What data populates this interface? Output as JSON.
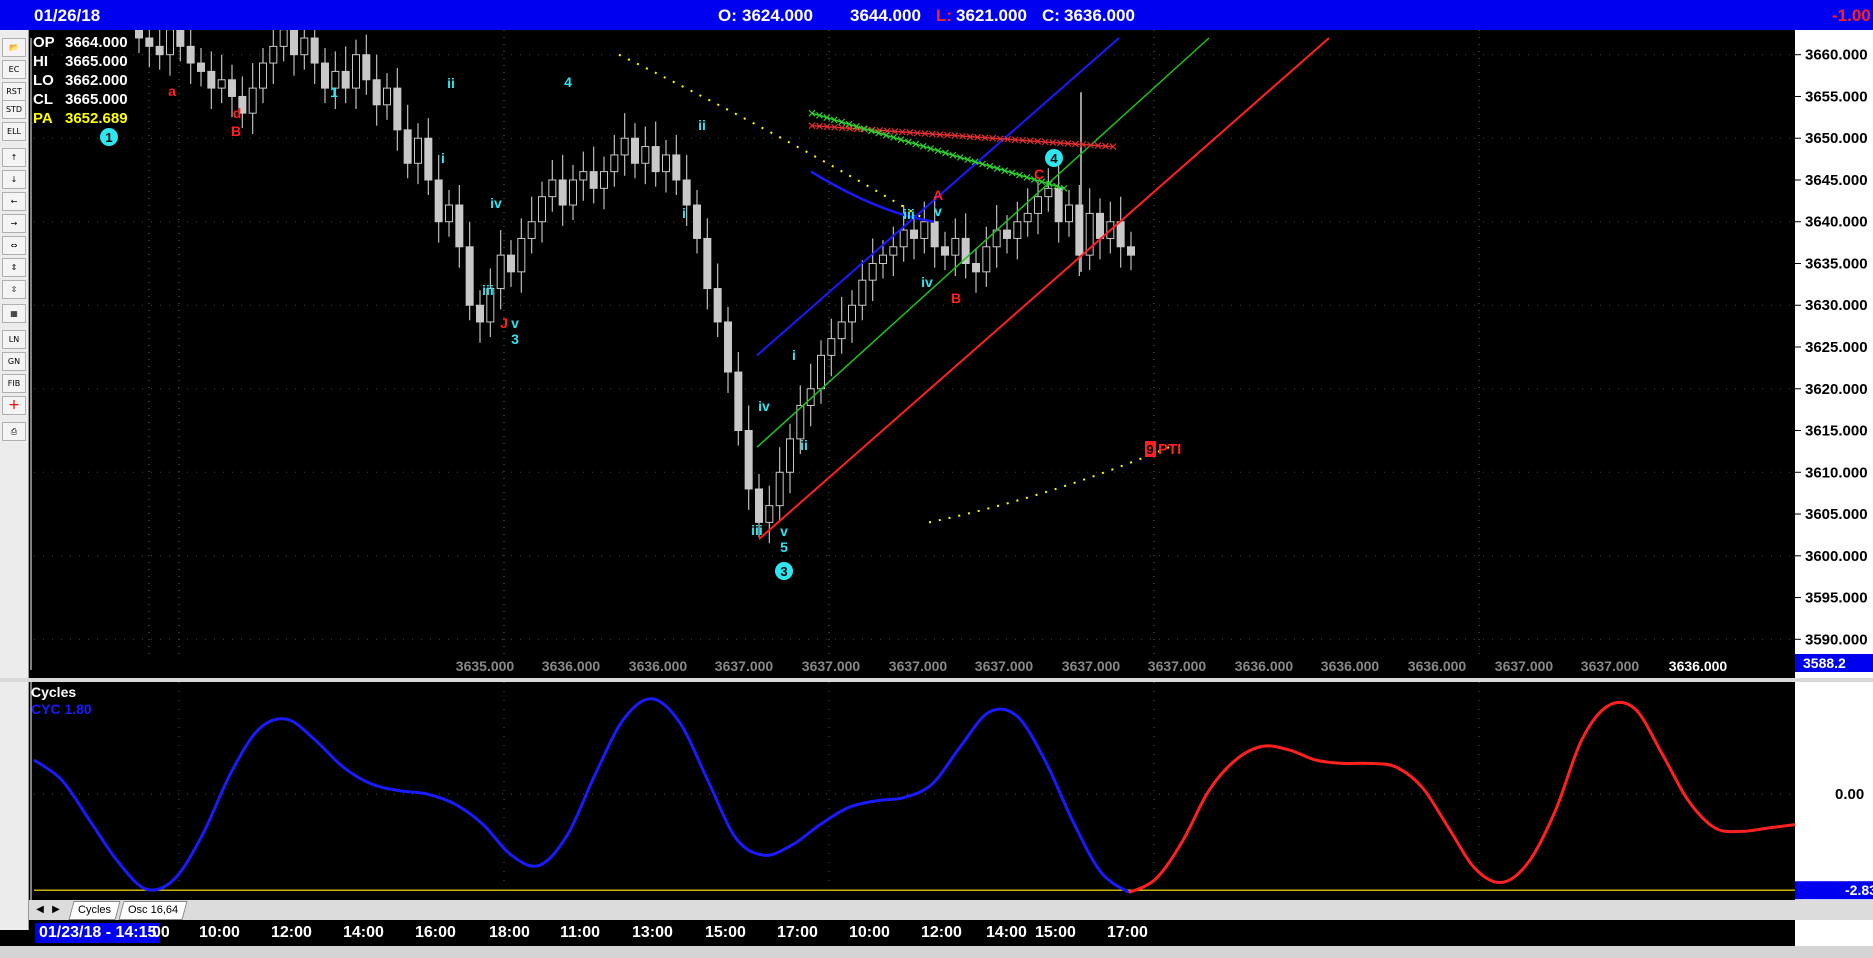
{
  "header": {
    "date": "01/26/18",
    "open_label": "O:",
    "open": "3624.000",
    "high": "3644.000",
    "low_label": "L:",
    "low": "3621.000",
    "close_label": "C:",
    "close": "3636.000",
    "change": "-1.00"
  },
  "toolbar": {
    "tools": [
      "open-folder",
      "elliott-count",
      "reset",
      "study",
      "elliott",
      "up",
      "down",
      "left",
      "right",
      "compress",
      "expand",
      "zoom",
      "grid",
      "lines",
      "gann",
      "fib",
      "crosshair",
      "print"
    ]
  },
  "readout": {
    "op_label": "OP",
    "op": "3664.000",
    "hi_label": "HI",
    "hi": "3665.000",
    "lo_label": "LO",
    "lo": "3662.000",
    "cl_label": "CL",
    "cl": "3665.000",
    "pa_label": "PA",
    "pa": "3652.689"
  },
  "price_axis": {
    "ticks": [
      "3660.000",
      "3655.000",
      "3650.000",
      "3645.000",
      "3640.000",
      "3635.000",
      "3630.000",
      "3625.000",
      "3620.000",
      "3615.000",
      "3610.000",
      "3605.000",
      "3600.000",
      "3595.000",
      "3590.000"
    ],
    "current_box": "3588.2"
  },
  "bottom_row_values": [
    "3635.000",
    "3636.000",
    "3636.000",
    "3637.000",
    "3637.000",
    "3637.000",
    "3637.000",
    "3637.000",
    "3637.000",
    "3636.000",
    "3636.000",
    "3636.000",
    "3637.000",
    "3637.000",
    "3636.000"
  ],
  "wave_labels": [
    {
      "t": "a",
      "c": "red"
    },
    {
      "t": "d",
      "c": "red"
    },
    {
      "t": "B",
      "c": "red"
    },
    {
      "t": "1",
      "c": "cyan"
    },
    {
      "t": "ii",
      "c": "cyan"
    },
    {
      "t": "i",
      "c": "cyan"
    },
    {
      "t": "iv",
      "c": "cyan"
    },
    {
      "t": "iii",
      "c": "cyan"
    },
    {
      "t": "J",
      "c": "red"
    },
    {
      "t": "v",
      "c": "cyan"
    },
    {
      "t": "3",
      "c": "cyan"
    },
    {
      "t": "4",
      "c": "cyan"
    },
    {
      "t": "ii",
      "c": "cyan"
    },
    {
      "t": "i",
      "c": "cyan"
    },
    {
      "t": "iv",
      "c": "cyan"
    },
    {
      "t": "iii",
      "c": "cyan"
    },
    {
      "t": "v",
      "c": "cyan"
    },
    {
      "t": "5",
      "c": "cyan"
    },
    {
      "t": "i",
      "c": "cyan"
    },
    {
      "t": "ii",
      "c": "cyan"
    },
    {
      "t": "iii",
      "c": "cyan"
    },
    {
      "t": "A",
      "c": "red"
    },
    {
      "t": "v",
      "c": "cyan"
    },
    {
      "t": "iv",
      "c": "cyan"
    },
    {
      "t": "B",
      "c": "red"
    },
    {
      "t": "C",
      "c": "red"
    }
  ],
  "circled_labels": [
    "1",
    "3",
    "4"
  ],
  "pti": {
    "score": "9",
    "label": "PTI"
  },
  "oscillator": {
    "title": "Cycles",
    "legend": "CYC 1.80",
    "zero_label": "0.00",
    "min_box": "-2.83"
  },
  "tabs": [
    "Cycles",
    "Osc 16,64"
  ],
  "time_axis": {
    "current_box": "01/23/18 - 14:15",
    "labels": [
      "00",
      "10:00",
      "12:00",
      "14:00",
      "16:00",
      "18:00",
      "11:00",
      "13:00",
      "15:00",
      "17:00",
      "10:00",
      "12:00",
      "14:00",
      "15:00",
      "17:00"
    ]
  },
  "colors": {
    "header_bg": "#0000f0",
    "up_channel": "#ff2020",
    "mid_channel": "#20c020",
    "top_channel": "#1a1aff",
    "osc_history": "#1a1aff",
    "osc_projection": "#ff2020",
    "labels_cyan": "#2ee6f0",
    "labels_red": "#ff2020"
  },
  "chart_data": {
    "type": "candlestick",
    "ylim": [
      3588,
      3662
    ],
    "bars_close": [
      3662,
      3661,
      3660,
      3663,
      3661,
      3659,
      3658,
      3656,
      3657,
      3655,
      3653,
      3656,
      3659,
      3661,
      3663,
      3660,
      3662,
      3659,
      3656,
      3658,
      3656,
      3660,
      3657,
      3654,
      3656,
      3651,
      3647,
      3650,
      3645,
      3640,
      3642,
      3637,
      3630,
      3628,
      3632,
      3636,
      3634,
      3638,
      3640,
      3643,
      3645,
      3642,
      3645,
      3646,
      3644,
      3646,
      3648,
      3650,
      3647,
      3649,
      3646,
      3648,
      3645,
      3642,
      3638,
      3632,
      3628,
      3622,
      3615,
      3608,
      3604,
      3606,
      3610,
      3614,
      3618,
      3620,
      3624,
      3626,
      3628,
      3630,
      3633,
      3635,
      3636,
      3637,
      3639,
      3638,
      3640,
      3637,
      3636,
      3638,
      3635,
      3634,
      3637,
      3639,
      3638,
      3640,
      3641,
      3643,
      3644,
      3640,
      3642,
      3636,
      3641,
      3638,
      3640,
      3637,
      3636
    ],
    "oscillator": {
      "history": [
        1.0,
        0.4,
        -0.8,
        -2.0,
        -2.8,
        -2.5,
        -1.2,
        0.6,
        1.9,
        2.2,
        1.6,
        0.8,
        0.3,
        0.1,
        0.0,
        -0.3,
        -0.9,
        -1.8,
        -2.1,
        -1.2,
        0.6,
        2.2,
        2.8,
        2.1,
        0.4,
        -1.3,
        -1.8,
        -1.5,
        -0.9,
        -0.4,
        -0.2,
        -0.1,
        0.3,
        1.4,
        2.4,
        2.3,
        1.0,
        -0.8,
        -2.3,
        -2.9
      ],
      "projection": [
        -2.9,
        -2.5,
        -1.4,
        0.1,
        1.0,
        1.4,
        1.3,
        1.0,
        0.9,
        0.9,
        0.8,
        0.2,
        -1.0,
        -2.2,
        -2.6,
        -2.0,
        -0.5,
        1.6,
        2.6,
        2.5,
        1.2,
        -0.2,
        -1.0,
        -1.1,
        -1.0,
        -0.9
      ]
    }
  }
}
